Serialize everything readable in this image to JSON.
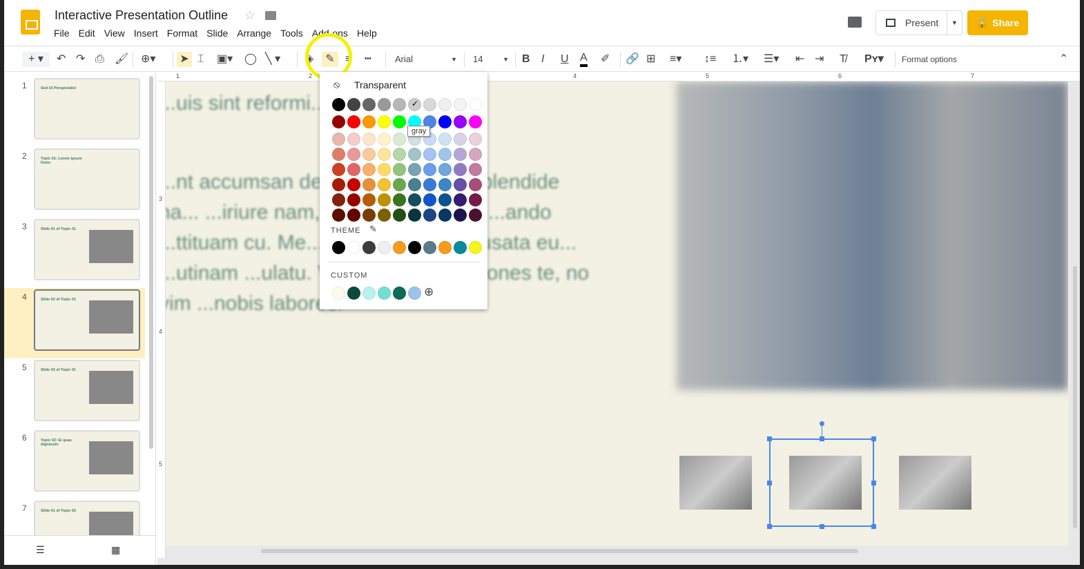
{
  "app": {
    "title": "Interactive Presentation Outline",
    "menu": [
      "File",
      "Edit",
      "View",
      "Insert",
      "Format",
      "Slide",
      "Arrange",
      "Tools",
      "Add-ons",
      "Help"
    ],
    "present_label": "Present",
    "share_label": "Share",
    "brand_color": "#f4b400"
  },
  "toolbar": {
    "font": "Arial",
    "font_size": "14",
    "format_options": "Format options",
    "active_tool": "border-color"
  },
  "ruler": {
    "h": [
      "1",
      "2",
      "4",
      "5",
      "6",
      "7"
    ],
    "v": [
      "3",
      "4",
      "5"
    ]
  },
  "slides": [
    {
      "num": "1",
      "title": "Sed Ut Perspiciatis!"
    },
    {
      "num": "2",
      "title": "Topic 01: Lorem Ipsum Dolor"
    },
    {
      "num": "3",
      "title": "Slide 01 of Topic 01"
    },
    {
      "num": "4",
      "title": "Slide 02 of Topic 01",
      "selected": true
    },
    {
      "num": "5",
      "title": "Slide 03 of Topic 01"
    },
    {
      "num": "6",
      "title": "Topic 02: Ei quas dignissim"
    },
    {
      "num": "7",
      "title": "Slide 01 of Topic 02"
    }
  ],
  "slide_text": [
    "...uis sint reformi...",
    "...nt accumsan de... ...Modus ...m splendide ha... ...iriure nam, ...e dissentiunt ... ...ando ...ttituam cu. Me... ...en sit, ...m accusata eu... ...utinam ...ulatu. Vis facilisi contentiones te, no vim ...nobis labores."
  ],
  "palette": {
    "transparent_label": "Transparent",
    "tooltip": "gray",
    "selected": "#cccccc",
    "standard": [
      [
        "#000000",
        "#434343",
        "#666666",
        "#999999",
        "#b7b7b7",
        "#cccccc",
        "#d9d9d9",
        "#efefef",
        "#f3f3f3",
        "#ffffff"
      ],
      [
        "#980000",
        "#ff0000",
        "#ff9900",
        "#ffff00",
        "#00ff00",
        "#00ffff",
        "#4a86e8",
        "#0000ff",
        "#9900ff",
        "#ff00ff"
      ],
      [
        "#e6b8af",
        "#f4cccc",
        "#fce5cd",
        "#fff2cc",
        "#d9ead3",
        "#d0e0e3",
        "#c9daf8",
        "#cfe2f3",
        "#d9d2e9",
        "#ead1dc"
      ],
      [
        "#dd7e6b",
        "#ea9999",
        "#f9cb9c",
        "#ffe599",
        "#b6d7a8",
        "#a2c4c9",
        "#a4c2f4",
        "#9fc5e8",
        "#b4a7d6",
        "#d5a6bd"
      ],
      [
        "#cc4125",
        "#e06666",
        "#f6b26b",
        "#ffd966",
        "#93c47d",
        "#76a5af",
        "#6d9eeb",
        "#6fa8dc",
        "#8e7cc3",
        "#c27ba0"
      ],
      [
        "#a61c00",
        "#cc0000",
        "#e69138",
        "#f1c232",
        "#6aa84f",
        "#45818e",
        "#3c78d8",
        "#3d85c6",
        "#674ea7",
        "#a64d79"
      ],
      [
        "#85200c",
        "#990000",
        "#b45f06",
        "#bf9000",
        "#38761d",
        "#134f5c",
        "#1155cc",
        "#0b5394",
        "#351c75",
        "#741b47"
      ],
      [
        "#5b0f00",
        "#660000",
        "#783f04",
        "#7f6000",
        "#274e13",
        "#0c343d",
        "#1c4587",
        "#073763",
        "#20124d",
        "#4c1130"
      ]
    ],
    "theme_label": "THEME",
    "theme": [
      "#000000",
      "#ffffff",
      "#3c3c3c",
      "#eeeff2",
      "#f79a1e",
      "#000000",
      "#5b7a8a",
      "#f79a1e",
      "#0a8a9a",
      "#f5f51e"
    ],
    "custom_label": "CUSTOM",
    "custom": [
      "#fdfbec",
      "#0b4a3c",
      "#b8f2ef",
      "#72dfd2",
      "#0d6b5a",
      "#9cc3ee"
    ]
  }
}
